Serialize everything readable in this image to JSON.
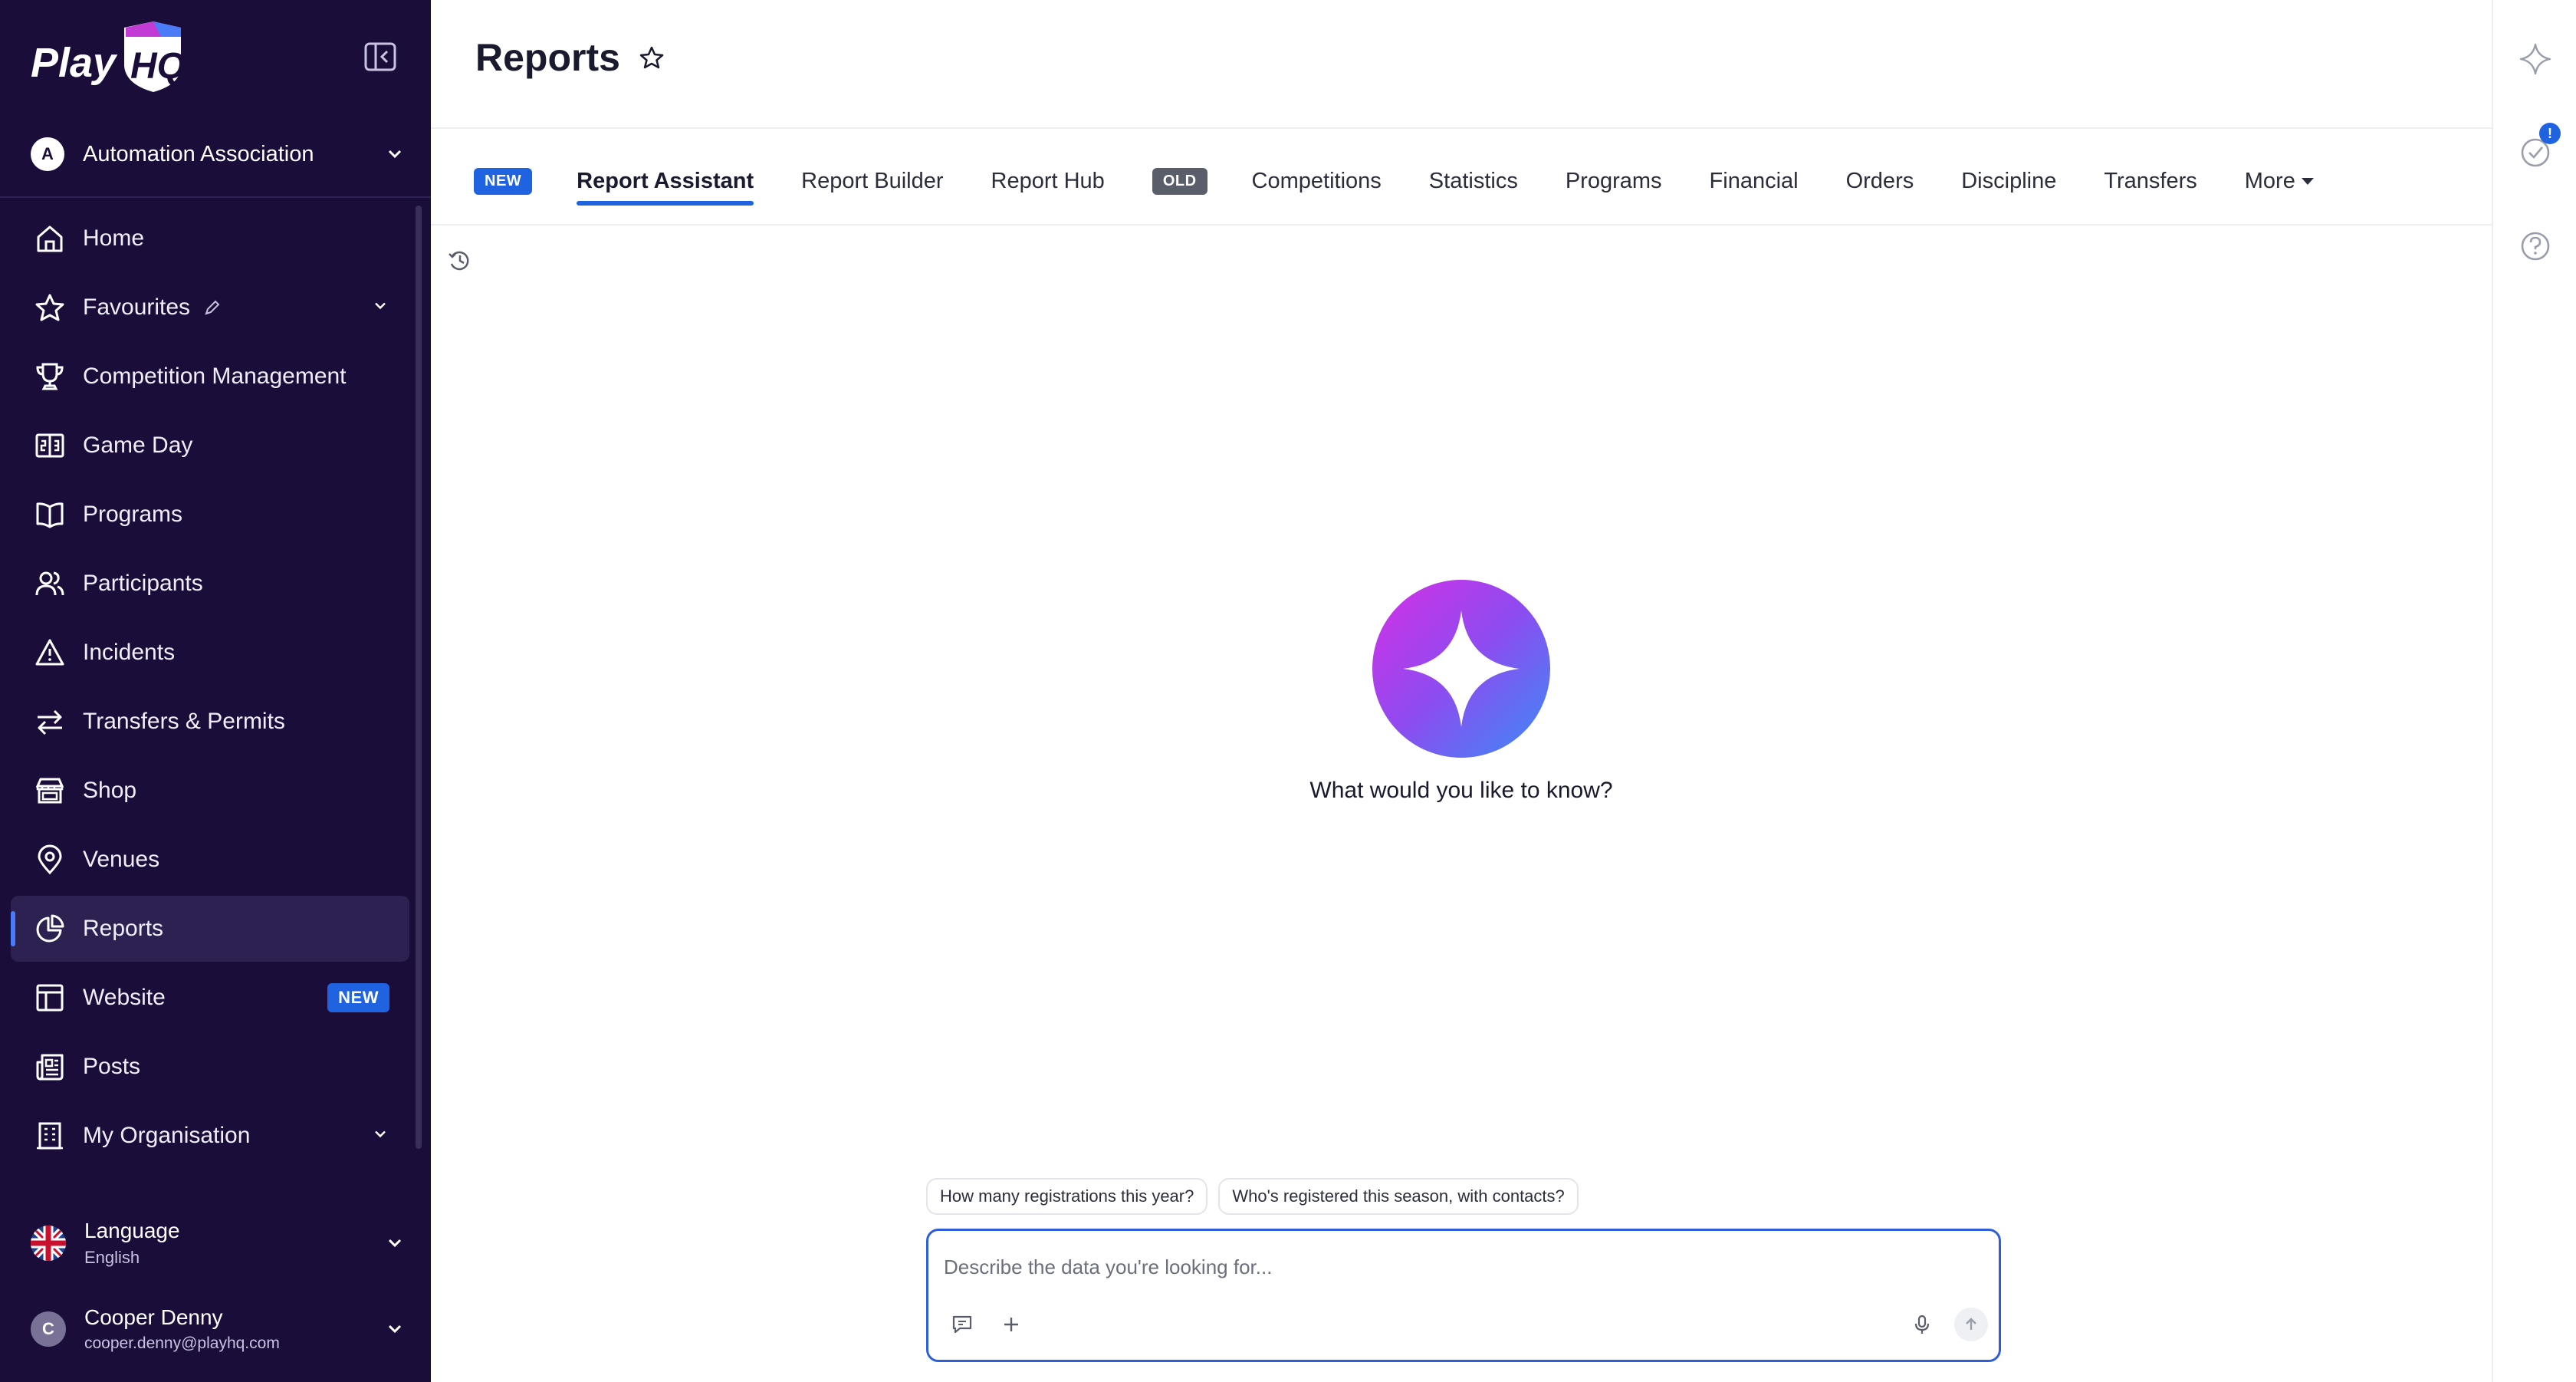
{
  "sidebar": {
    "org": {
      "initial": "A",
      "name": "Automation Association"
    },
    "items": [
      {
        "key": "home",
        "label": "Home",
        "icon": "home-icon"
      },
      {
        "key": "favourites",
        "label": "Favourites",
        "icon": "star-icon"
      },
      {
        "key": "competition-management",
        "label": "Competition Management",
        "icon": "trophy-icon"
      },
      {
        "key": "game-day",
        "label": "Game Day",
        "icon": "scoreboard-icon"
      },
      {
        "key": "programs",
        "label": "Programs",
        "icon": "book-icon"
      },
      {
        "key": "participants",
        "label": "Participants",
        "icon": "people-icon"
      },
      {
        "key": "incidents",
        "label": "Incidents",
        "icon": "warning-icon"
      },
      {
        "key": "transfers-permits",
        "label": "Transfers & Permits",
        "icon": "arrows-icon"
      },
      {
        "key": "shop",
        "label": "Shop",
        "icon": "store-icon"
      },
      {
        "key": "venues",
        "label": "Venues",
        "icon": "location-pin-icon"
      },
      {
        "key": "reports",
        "label": "Reports",
        "icon": "pie-chart-icon"
      },
      {
        "key": "website",
        "label": "Website",
        "icon": "layout-icon",
        "badge": "NEW"
      },
      {
        "key": "posts",
        "label": "Posts",
        "icon": "newspaper-icon"
      },
      {
        "key": "my-organisation",
        "label": "My Organisation",
        "icon": "building-icon"
      }
    ],
    "language": {
      "label": "Language",
      "value": "English"
    },
    "user": {
      "initial": "C",
      "name": "Cooper Denny",
      "email": "cooper.denny@playhq.com"
    }
  },
  "header": {
    "title": "Reports"
  },
  "tabs": {
    "new_badge": "NEW",
    "old_badge": "OLD",
    "items": [
      {
        "label": "Report Assistant",
        "active": true
      },
      {
        "label": "Report Builder"
      },
      {
        "label": "Report Hub"
      },
      {
        "label": "Competitions"
      },
      {
        "label": "Statistics"
      },
      {
        "label": "Programs"
      },
      {
        "label": "Financial"
      },
      {
        "label": "Orders"
      },
      {
        "label": "Discipline"
      },
      {
        "label": "Transfers"
      },
      {
        "label": "More"
      }
    ]
  },
  "assistant": {
    "prompt": "What would you like to know?",
    "suggestions": [
      "How many registrations this year?",
      "Who's registered this season, with contacts?"
    ],
    "input_placeholder": "Describe the data you're looking for...",
    "input_value": ""
  },
  "rail": {
    "notification_count": "!"
  },
  "colors": {
    "sidebar_bg": "#1a0d3a",
    "accent": "#1f63e0",
    "old_badge": "#5a5e6b"
  }
}
